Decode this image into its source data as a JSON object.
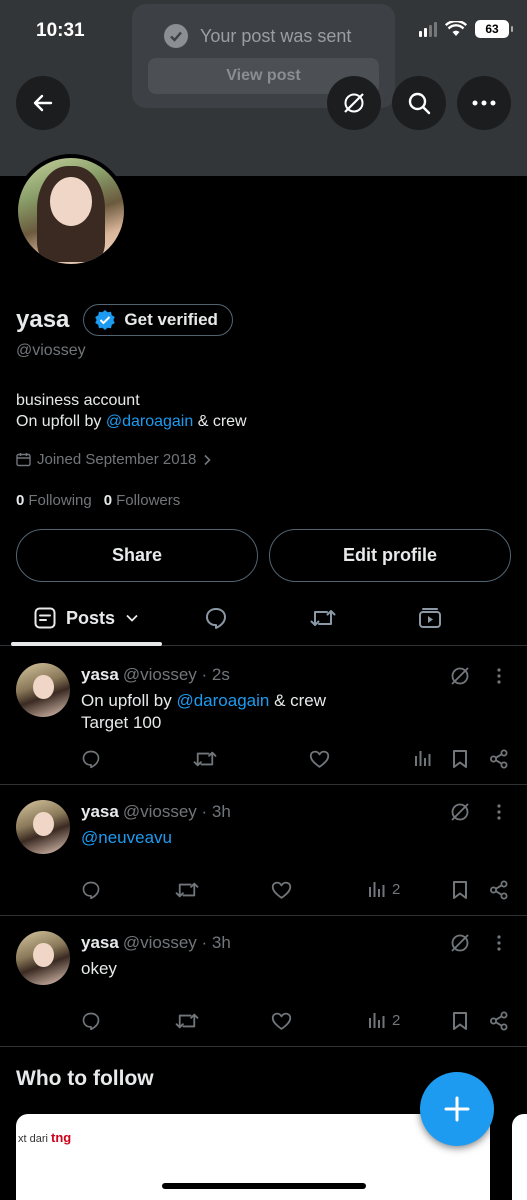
{
  "status_bar": {
    "time": "10:31",
    "battery": "63"
  },
  "toast": {
    "message": "Your post was sent",
    "action_label": "View post"
  },
  "profile": {
    "name": "yasa",
    "verify_label": "Get verified",
    "handle": "@viossey",
    "bio_line1": "business account",
    "bio_line2_prefix": "On upfoll by ",
    "bio_line2_mention": "@daroagain",
    "bio_line2_suffix": " & crew",
    "joined": "Joined September 2018",
    "following_count": "0",
    "following_label": "Following",
    "followers_count": "0",
    "followers_label": "Followers",
    "share_label": "Share",
    "edit_label": "Edit profile"
  },
  "tabs": {
    "posts_label": "Posts"
  },
  "posts": [
    {
      "name": "yasa",
      "meta": "@viossey · 2s",
      "text_prefix": "On upfoll by ",
      "mention": "@daroagain",
      "text_suffix": " & crew",
      "line2": "Target 100",
      "views": ""
    },
    {
      "name": "yasa",
      "meta": "@viossey · 3h",
      "mention": "@neuveavu",
      "views": "2"
    },
    {
      "name": "yasa",
      "meta": "@viossey · 3h",
      "text": "okey",
      "views": "2"
    }
  ],
  "who_to_follow": {
    "title": "Who to follow",
    "card_text": "xt dari ",
    "card_brand": "tng"
  },
  "colors": {
    "accent": "#1d9bf0",
    "background": "#000000",
    "muted": "#71767b"
  }
}
